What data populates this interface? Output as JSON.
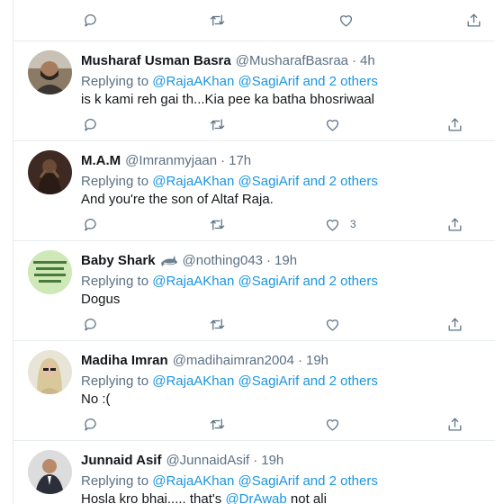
{
  "replying_label": "Replying to",
  "tweets": [
    {
      "name": "Musharaf Usman Basra",
      "handle": "@MusharafBasraa",
      "time": "4h",
      "mentions": [
        "@RajaAKhan",
        "@SagiArif",
        "and 2 others"
      ],
      "text_parts": [
        "is k kami reh gai th...Kia pee ka batha bhosriwaal"
      ]
    },
    {
      "name": "M.A.M",
      "handle": "@Imranmyjaan",
      "time": "17h",
      "mentions": [
        "@RajaAKhan",
        "@SagiArif",
        "and 2 others"
      ],
      "text_parts": [
        "And you're the son of Altaf Raja."
      ],
      "like_count": "3"
    },
    {
      "name": "Baby Shark",
      "handle": "@nothing043",
      "time": "19h",
      "mentions": [
        "@RajaAKhan",
        "@SagiArif",
        "and 2 others"
      ],
      "text_parts": [
        "Dogus"
      ],
      "name_icon": "shark-emoji-icon"
    },
    {
      "name": "Madiha Imran",
      "handle": "@madihaimran2004",
      "time": "19h",
      "mentions": [
        "@RajaAKhan",
        "@SagiArif",
        "and 2 others"
      ],
      "text_parts": [
        "No :("
      ]
    },
    {
      "name": "Junnaid Asif",
      "handle": "@JunnaidAsif",
      "time": "19h",
      "mentions": [
        "@RajaAKhan",
        "@SagiArif",
        "and 2 others"
      ],
      "text_parts": [
        "Hosla kro bhai..... that's ",
        "@DrAwab",
        " not ali"
      ]
    }
  ],
  "icons": {
    "reply": "reply-icon",
    "retweet": "retweet-icon",
    "like": "heart-icon",
    "share": "share-icon"
  },
  "colors": {
    "link": "#1b95e0",
    "secondary_text": "#5b7083",
    "divider": "#e6ecf0"
  }
}
